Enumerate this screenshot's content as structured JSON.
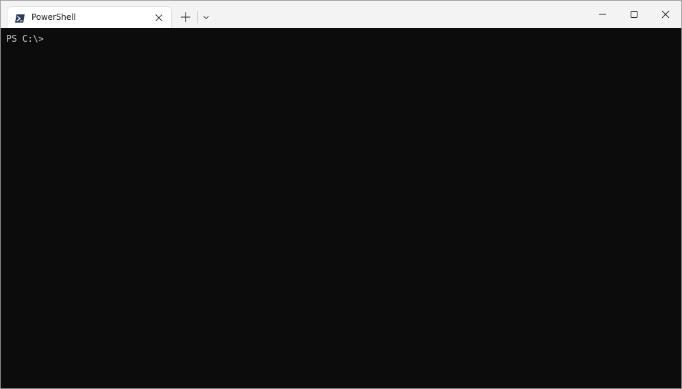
{
  "window": {
    "tab": {
      "title": "PowerShell",
      "icon": "powershell-icon",
      "close_icon": "close-icon"
    },
    "new_tab_icon": "plus-icon",
    "dropdown_icon": "chevron-down-icon",
    "caption_buttons": {
      "minimize_icon": "minimize-icon",
      "maximize_icon": "maximize-icon",
      "close_icon": "close-icon"
    }
  },
  "terminal": {
    "prompt": "PS C:\\>",
    "background": "#0c0c0c",
    "foreground": "#cccccc"
  }
}
